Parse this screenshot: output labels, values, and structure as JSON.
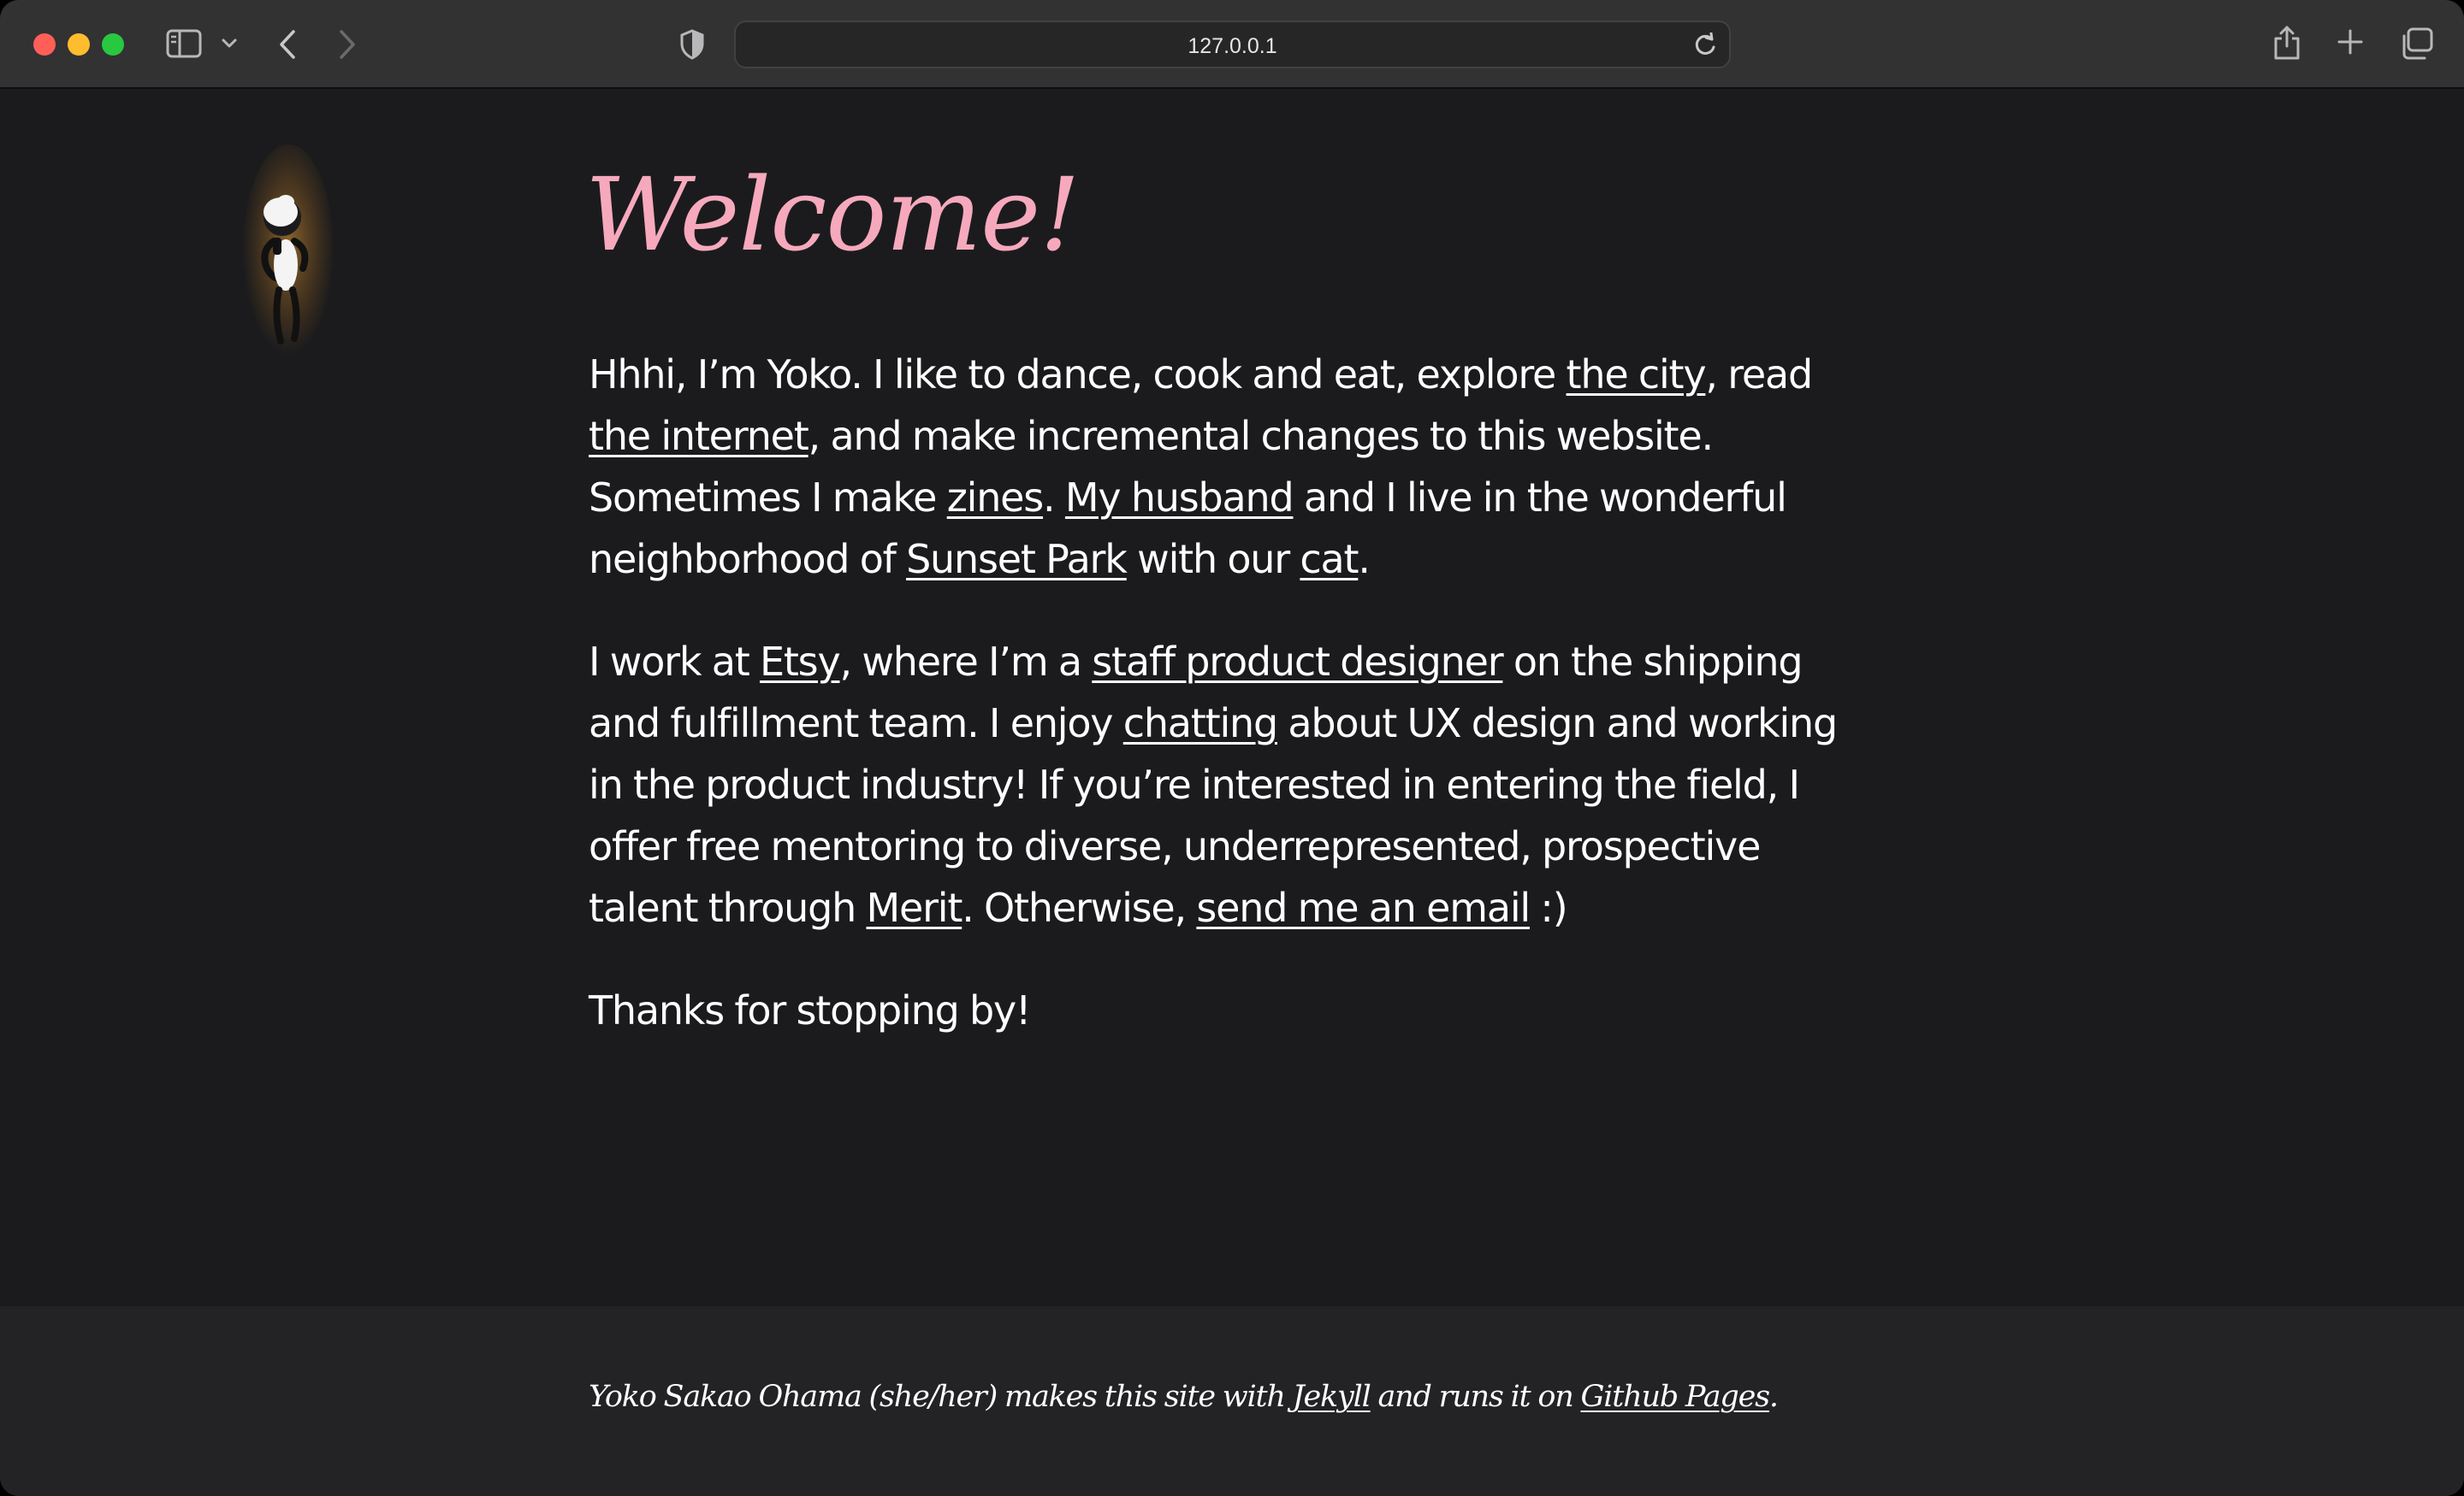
{
  "browser": {
    "url": "127.0.0.1",
    "traffic_lights": {
      "close": "#ff5f57",
      "minimize": "#febc2e",
      "zoom": "#28c840"
    }
  },
  "page": {
    "heading": "Welcome!",
    "heading_color": "#f6a9bd",
    "background": "#1b1b1d",
    "intro": {
      "t1": "Hhhi, I’m Yoko. I like to dance, cook and eat, explore ",
      "link_city": "the city",
      "t2": ", read ",
      "link_internet": "the internet",
      "t3": ", and make incremental changes to this website. Sometimes I make ",
      "link_zines": "zines",
      "t4": ". ",
      "link_husband": "My husband",
      "t5": " and I live in the wonderful neighborhood of ",
      "link_sunset_park": "Sunset Park",
      "t6": " with our ",
      "link_cat": "cat",
      "t7": "."
    },
    "work": {
      "t1": "I work at ",
      "link_etsy": "Etsy",
      "t2": ", where I’m a ",
      "link_role": "staff product designer",
      "t3": " on the shipping and fulfillment team. I enjoy ",
      "link_chatting": "chatting",
      "t4": " about UX design and working in the product industry! If you’re interested in entering the field, I offer free mentoring to diverse, underrepresented, prospective talent through ",
      "link_merit": "Merit",
      "t5": ". Otherwise, ",
      "link_email": "send me an email",
      "t6": " :)"
    },
    "closing": "Thanks for stopping by!"
  },
  "footer": {
    "t1": "Yoko Sakao Ohama (she/her) makes this site with ",
    "link_jekyll": "Jekyll",
    "t2": " and runs it on ",
    "link_github_pages": "Github Pages",
    "t3": "."
  },
  "icons": {
    "sidebar": "sidebar-icon",
    "chevron": "chevron-down-icon",
    "back": "back-arrow-icon",
    "forward": "forward-arrow-icon",
    "privacy": "shield-icon",
    "reload": "reload-icon",
    "share": "share-icon",
    "new_tab": "plus-icon",
    "tabs": "tabs-overview-icon"
  }
}
